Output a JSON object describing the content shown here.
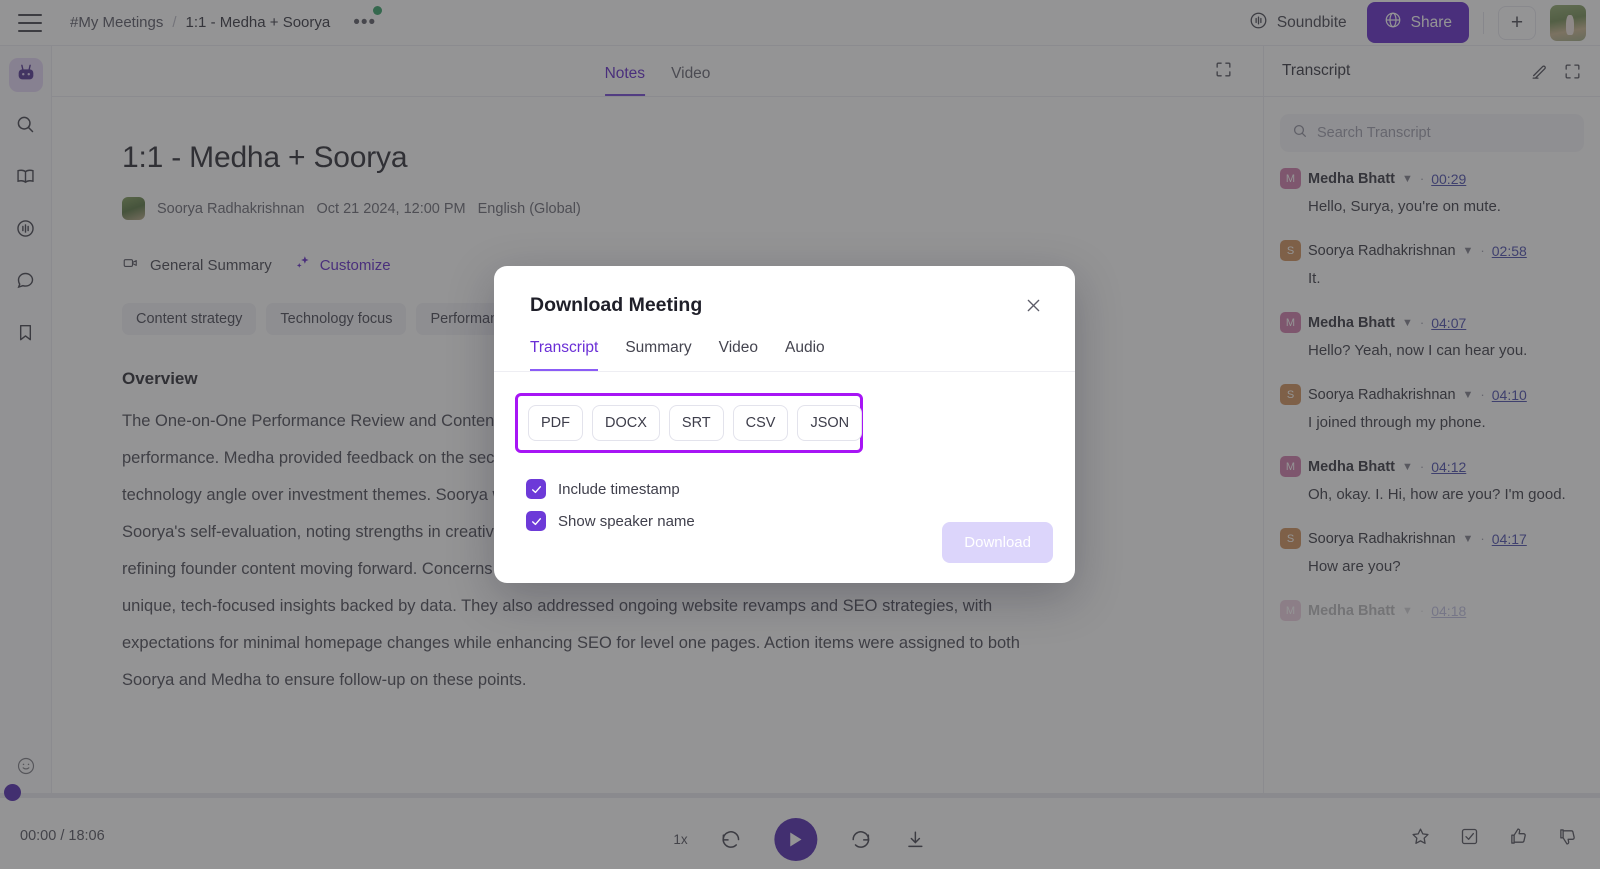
{
  "topbar": {
    "menu_icon": "hamburger-icon",
    "breadcrumb_root": "#My Meetings",
    "breadcrumb_sep": "/",
    "breadcrumb_current": "1:1 - Medha + Soorya",
    "more_dots": "•••",
    "soundbite_label": "Soundbite",
    "share_label": "Share",
    "plus_label": "+"
  },
  "rail": {
    "items": [
      {
        "name": "assistant-bot",
        "icon": "robot-icon",
        "active": true
      },
      {
        "name": "search",
        "icon": "search-icon",
        "active": false
      },
      {
        "name": "library",
        "icon": "book-icon",
        "active": false
      },
      {
        "name": "soundbites",
        "icon": "soundwave-icon",
        "active": false
      },
      {
        "name": "chat",
        "icon": "chat-bubble-icon",
        "active": false
      },
      {
        "name": "bookmarks",
        "icon": "bookmark-icon",
        "active": false
      }
    ],
    "bottom_icon": "smiley-icon"
  },
  "center": {
    "tabs": [
      {
        "label": "Notes",
        "active": true
      },
      {
        "label": "Video",
        "active": false
      }
    ],
    "expand_icon": "expand-icon",
    "title": "1:1 - Medha + Soorya",
    "meta": {
      "owner": "Soorya Radhakrishnan",
      "datetime": "Oct 21 2024, 12:00 PM",
      "language": "English (Global)"
    },
    "summary_type": "General Summary",
    "summary_type_icon": "video-camera-icon",
    "customize_label": "Customize",
    "customize_icon": "sparkle-icon",
    "chips": [
      "Content strategy",
      "Technology focus",
      "Performance"
    ],
    "overview_heading": "Overview",
    "overview_text": "The One-on-One Performance Review and Content Strategy meeting focused on evaluating Soorya's article drafts and performance. Medha provided feedback on the second draft of an article which showed significant improvement, favoring a technology angle over investment themes. Soorya will submit a revised version with enhanced relatability. Medha reviewed Soorya's self-evaluation, noting strengths in creativity, technical skills, and overall team contribution, with an emphasis on refining founder content moving forward. Concerns about potential plagiarism were raised, leading to recommendations for unique, tech-focused insights backed by data. They also addressed ongoing website revamps and SEO strategies, with expectations for minimal homepage changes while enhancing SEO for level one pages. Action items were assigned to both Soorya and Medha to ensure follow-up on these points."
  },
  "transcript": {
    "title": "Transcript",
    "edit_icon": "pencil-icon",
    "expand_icon": "expand-icon",
    "search_placeholder": "Search Transcript",
    "search_value": "",
    "search_icon": "search-icon",
    "lines": [
      {
        "initial": "M",
        "speaker": "Medha Bhatt",
        "time": "00:29",
        "text": "Hello, Surya, you're on mute."
      },
      {
        "initial": "S",
        "speaker": "Soorya Radhakrishnan",
        "time": "02:58",
        "text": "It."
      },
      {
        "initial": "M",
        "speaker": "Medha Bhatt",
        "time": "04:07",
        "text": "Hello? Yeah, now I can hear you."
      },
      {
        "initial": "S",
        "speaker": "Soorya Radhakrishnan",
        "time": "04:10",
        "text": "I joined through my phone."
      },
      {
        "initial": "M",
        "speaker": "Medha Bhatt",
        "time": "04:12",
        "text": "Oh, okay. I. Hi, how are you? I'm good."
      },
      {
        "initial": "S",
        "speaker": "Soorya Radhakrishnan",
        "time": "04:17",
        "text": "How are you?"
      },
      {
        "initial": "M",
        "speaker": "Medha Bhatt",
        "time": "04:18",
        "text": ""
      }
    ]
  },
  "player": {
    "current_time": "00:00",
    "separator": "/",
    "total_time": "18:06",
    "speed": "1x",
    "rewind_icon": "rewind-15-icon",
    "play_icon": "play-icon",
    "forward_icon": "forward-15-icon",
    "download_icon": "download-icon",
    "right_icons": [
      "star-icon",
      "task-check-icon",
      "thumbs-up-icon",
      "thumbs-down-icon"
    ]
  },
  "modal": {
    "title": "Download Meeting",
    "close_icon": "close-icon",
    "tabs": [
      {
        "label": "Transcript",
        "active": true
      },
      {
        "label": "Summary",
        "active": false
      },
      {
        "label": "Video",
        "active": false
      },
      {
        "label": "Audio",
        "active": false
      }
    ],
    "formats": [
      "PDF",
      "DOCX",
      "SRT",
      "CSV",
      "JSON"
    ],
    "options": [
      {
        "label": "Include timestamp",
        "checked": true
      },
      {
        "label": "Show speaker name",
        "checked": true
      }
    ],
    "download_label": "Download",
    "highlight_color": "#a715f5"
  },
  "colors": {
    "accent_purple": "#5b21c7",
    "tab_purple": "#6a2ed6",
    "highlight": "#a715f5",
    "green_dot": "#2e9e63",
    "avatar_m": "#cf77a8",
    "avatar_s": "#cf8d54"
  }
}
